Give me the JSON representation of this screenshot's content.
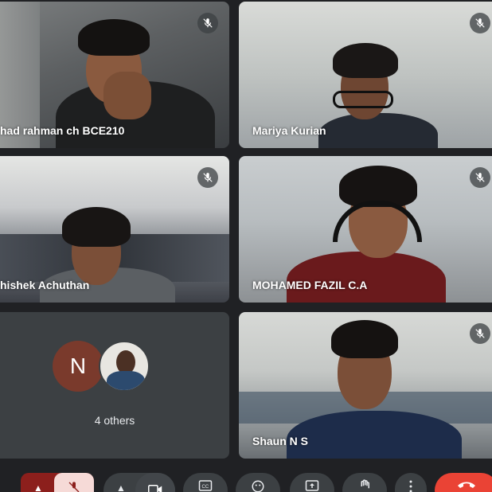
{
  "participants": [
    {
      "name": "had rahman ch BCE210",
      "muted": true
    },
    {
      "name": "Mariya Kurian",
      "muted": true
    },
    {
      "name": "hishek Achuthan",
      "muted": true
    },
    {
      "name": "MOHAMED FAZIL C.A",
      "muted": true
    },
    {
      "name": "Shaun N S",
      "muted": true
    }
  ],
  "others": {
    "initial": "N",
    "label": "4 others"
  },
  "controls": {
    "mic_state": "muted",
    "icons": [
      "mic-off-icon",
      "videocam-icon",
      "captions-icon",
      "emoji-icon",
      "present-icon",
      "raise-hand-icon",
      "more-vert-icon",
      "call-end-icon"
    ]
  },
  "colors": {
    "background": "#202124",
    "tile": "#3c4043",
    "end_call": "#ea4335",
    "mic_muted": "#8c1f1c"
  }
}
